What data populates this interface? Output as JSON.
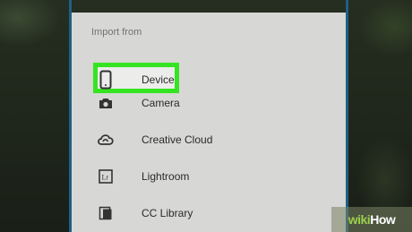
{
  "dialog": {
    "header": "Import from",
    "items": [
      {
        "label": "Device",
        "icon": "phone-icon"
      },
      {
        "label": "Camera",
        "icon": "camera-icon"
      },
      {
        "label": "Creative Cloud",
        "icon": "creative-cloud-icon"
      },
      {
        "label": "Lightroom",
        "icon": "lightroom-icon"
      },
      {
        "label": "CC Library",
        "icon": "library-icon"
      }
    ]
  },
  "watermark": {
    "prefix": "wiki",
    "suffix": "How"
  },
  "colors": {
    "highlight": "#35e421",
    "panel": "#d7d7d5",
    "accent_edge": "#1f5f86"
  }
}
